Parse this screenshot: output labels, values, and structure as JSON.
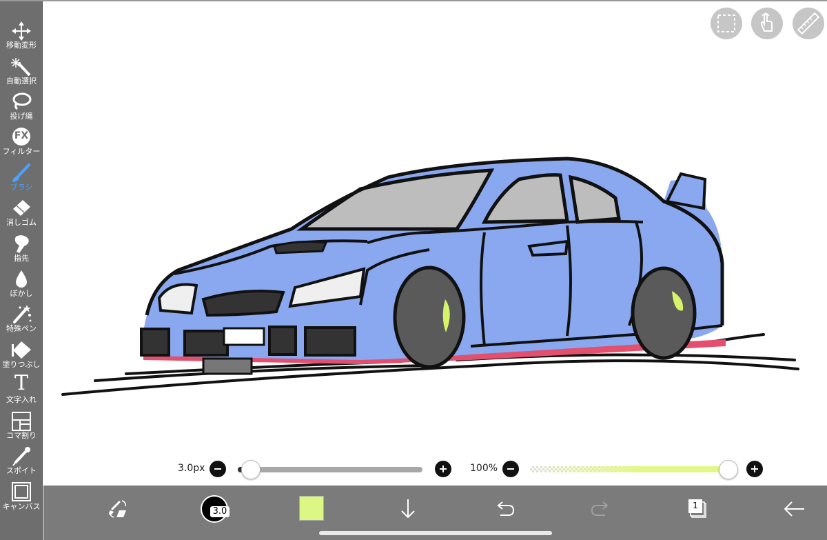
{
  "toolbar": {
    "tools": [
      {
        "label": "移動変形",
        "icon": "move-icon"
      },
      {
        "label": "自動選択",
        "icon": "magic-wand-icon"
      },
      {
        "label": "投げ縄",
        "icon": "lasso-icon"
      },
      {
        "label": "フィルター",
        "icon": "fx-icon",
        "glyph": "FX"
      },
      {
        "label": "ブラシ",
        "icon": "brush-icon",
        "active": true
      },
      {
        "label": "消しゴム",
        "icon": "eraser-icon"
      },
      {
        "label": "指先",
        "icon": "finger-icon"
      },
      {
        "label": "ぼかし",
        "icon": "blur-drop-icon"
      },
      {
        "label": "特殊ペン",
        "icon": "special-pen-icon"
      },
      {
        "label": "塗りつぶし",
        "icon": "fill-bucket-icon"
      },
      {
        "label": "文字入れ",
        "icon": "text-icon",
        "glyph": "T"
      },
      {
        "label": "コマ割り",
        "icon": "panel-layout-icon"
      },
      {
        "label": "スポイト",
        "icon": "eyedropper-icon"
      },
      {
        "label": "キャンバス",
        "icon": "canvas-icon"
      }
    ],
    "active_color": "#4aa3ff"
  },
  "top_buttons": [
    {
      "name": "selection-icon"
    },
    {
      "name": "touch-gesture-icon"
    },
    {
      "name": "ruler-icon"
    }
  ],
  "sliders": {
    "brush_size": {
      "label": "3.0px",
      "value": 3.0,
      "fraction": 0.03
    },
    "opacity": {
      "label": "100%",
      "value": 100,
      "fraction": 1.0,
      "color": "#e2f78a"
    }
  },
  "bottom_bar": {
    "brush_size_badge": "3.0",
    "current_color": "#dcf784",
    "layer_count": "1",
    "items": [
      "swap-tool-icon",
      "brush-size-icon",
      "color-swatch",
      "download-arrow-icon",
      "undo-icon",
      "redo-icon",
      "layers-icon",
      "back-arrow-icon"
    ]
  },
  "colors": {
    "toolbar_bg": "#6e6e6e",
    "bottom_bar_bg": "#7b7b7b",
    "car_body": "#8aa8ef",
    "car_window": "#bdbdbd",
    "car_accent_red": "#e2506e",
    "wheel_accent": "#d7f36a"
  }
}
